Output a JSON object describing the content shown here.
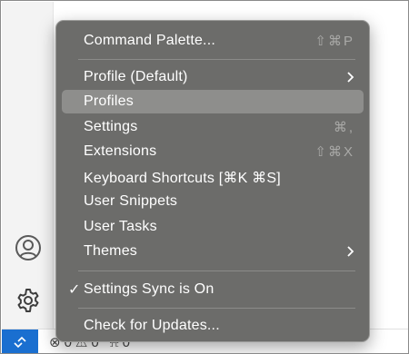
{
  "menu": {
    "command_palette": {
      "label": "Command Palette...",
      "shortcut": "⇧⌘P"
    },
    "profile_default": {
      "label": "Profile (Default)"
    },
    "profiles": {
      "label": "Profiles"
    },
    "settings": {
      "label": "Settings",
      "shortcut": "⌘,"
    },
    "extensions": {
      "label": "Extensions",
      "shortcut": "⇧⌘X"
    },
    "keyboard_shortcuts": {
      "label": "Keyboard Shortcuts [⌘K ⌘S]"
    },
    "user_snippets": {
      "label": "User Snippets"
    },
    "user_tasks": {
      "label": "User Tasks"
    },
    "themes": {
      "label": "Themes"
    },
    "settings_sync": {
      "label": "Settings Sync is On",
      "check": "✓"
    },
    "check_updates": {
      "label": "Check for Updates..."
    }
  },
  "activity_bar": {
    "icons": [
      "account-icon",
      "gear-icon"
    ]
  },
  "status_bar": {
    "errors": "0",
    "warnings": "0",
    "ports": "0"
  },
  "colors": {
    "menu_bg": "#6c6c6a",
    "menu_selected": "#8e8e8c",
    "remote_accent": "#1a6fd0"
  }
}
